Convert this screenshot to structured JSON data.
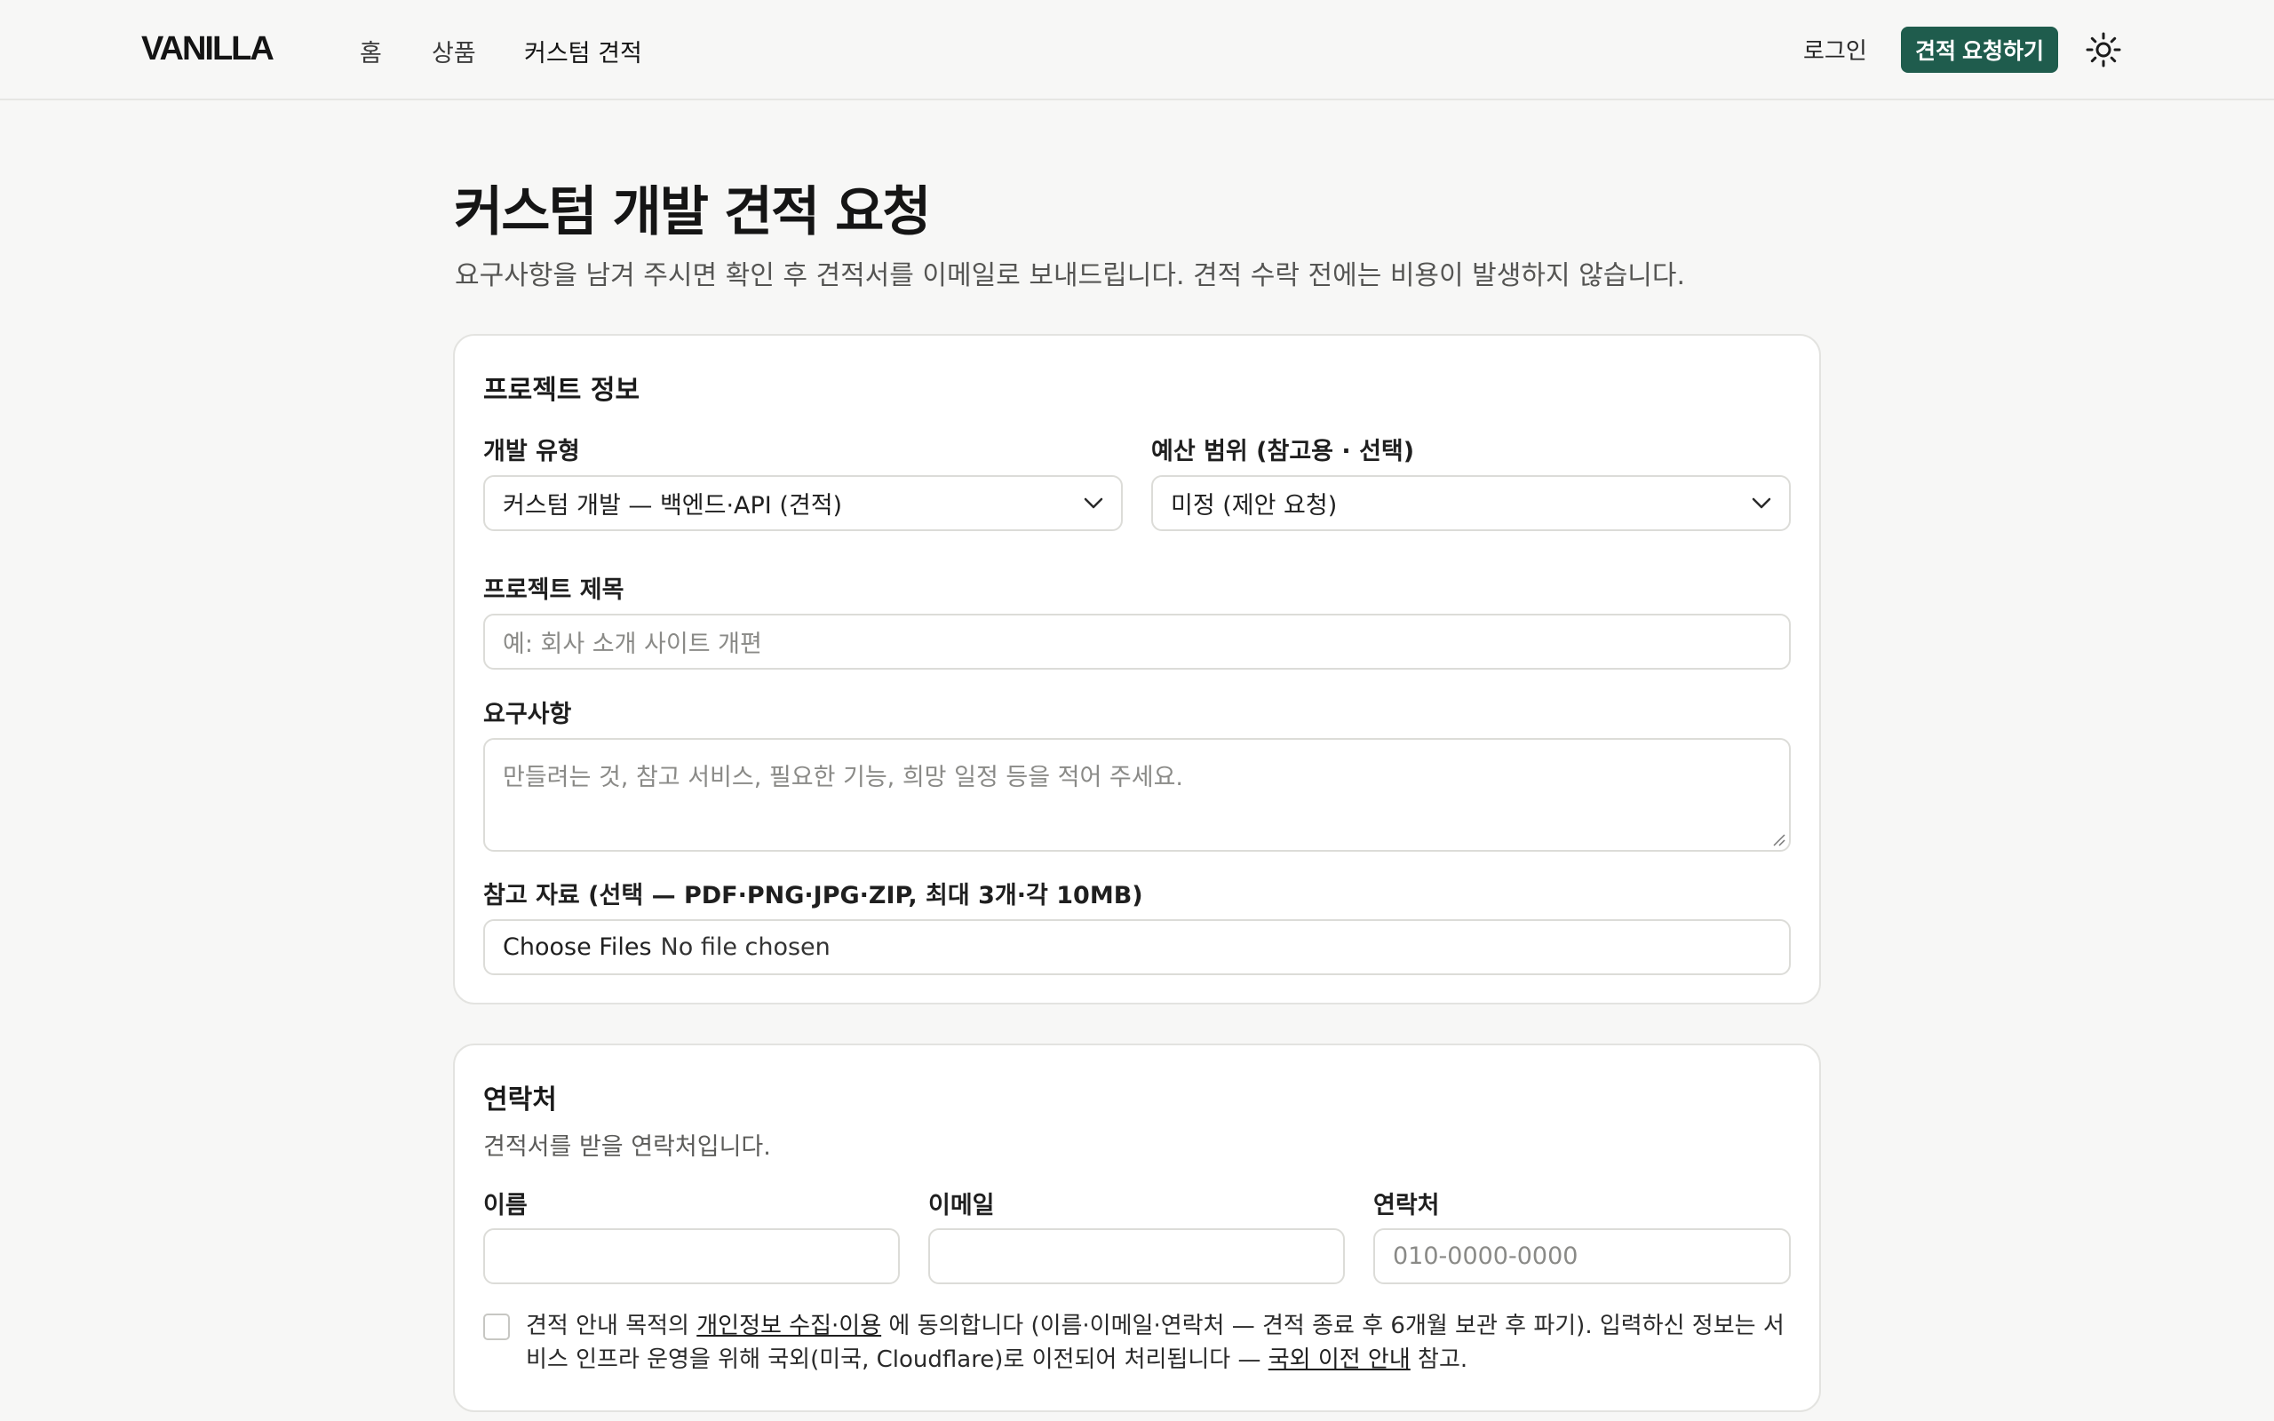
{
  "header": {
    "logo": "VANILLA",
    "nav": [
      {
        "label": "홈"
      },
      {
        "label": "상품"
      },
      {
        "label": "커스텀 견적"
      }
    ],
    "login_label": "로그인",
    "cta_label": "견적 요청하기",
    "theme_icon": "sun-icon"
  },
  "page": {
    "title": "커스텀 개발 견적 요청",
    "subtitle": "요구사항을 남겨 주시면 확인 후 견적서를 이메일로 보내드립니다. 견적 수락 전에는 비용이 발생하지 않습니다."
  },
  "project": {
    "section_title": "프로젝트 정보",
    "dev_type": {
      "label": "개발 유형",
      "value": "커스텀 개발 — 백엔드·API (견적)"
    },
    "budget": {
      "label": "예산 범위 (참고용 · 선택)",
      "value": "미정 (제안 요청)"
    },
    "title_field": {
      "label": "프로젝트 제목",
      "placeholder": "예: 회사 소개 사이트 개편"
    },
    "requirements": {
      "label": "요구사항",
      "placeholder": "만들려는 것, 참고 서비스, 필요한 기능, 희망 일정 등을 적어 주세요."
    },
    "attachments": {
      "label": "참고 자료 (선택 — PDF·PNG·JPG·ZIP, 최대 3개·각 10MB)",
      "choose_label": "Choose Files",
      "status": "No file chosen"
    }
  },
  "contact": {
    "section_title": "연락처",
    "description": "견적서를 받을 연락처입니다.",
    "name": {
      "label": "이름",
      "value": ""
    },
    "email": {
      "label": "이메일",
      "value": ""
    },
    "phone": {
      "label": "연락처",
      "placeholder": "010-0000-0000"
    },
    "consent": {
      "text_1": "견적 안내 목적의 ",
      "link_1": "개인정보 수집·이용",
      "text_2": " 에 동의합니다 (이름·이메일·연락처 — 견적 종료 후 6개월 보관 후 파기). 입력하신 정보는 서비스 인프라 운영을 위해 국외(미국, Cloudflare)로 이전되어 처리됩니다 — ",
      "link_2": "국외 이전 안내",
      "text_3": " 참고.",
      "checked": false
    }
  },
  "colors": {
    "accent": "#1f5c4d",
    "background": "#f7f7f6",
    "card": "#ffffff"
  }
}
